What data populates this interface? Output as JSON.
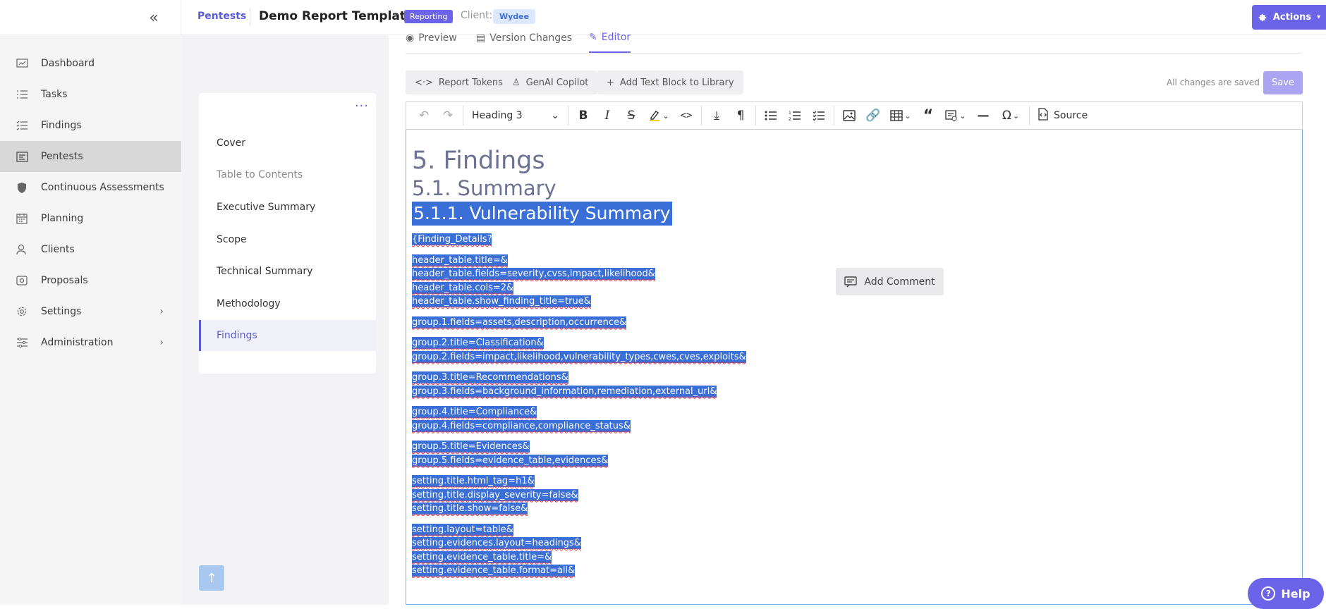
{
  "topbar": {
    "breadcrumb": "Pentests",
    "title": "Demo Report Template",
    "status_badge": "Reporting",
    "client_label": "Client:",
    "client_name": "Wydee",
    "actions_label": "Actions"
  },
  "sidebar": {
    "items": [
      {
        "label": "Dashboard",
        "icon": "dashboard-icon"
      },
      {
        "label": "Tasks",
        "icon": "tasks-icon"
      },
      {
        "label": "Findings",
        "icon": "findings-icon"
      },
      {
        "label": "Pentests",
        "icon": "pentests-icon",
        "active": true
      },
      {
        "label": "Continuous Assessments",
        "icon": "shield-icon"
      },
      {
        "label": "Planning",
        "icon": "calendar-icon"
      },
      {
        "label": "Clients",
        "icon": "clients-icon"
      },
      {
        "label": "Proposals",
        "icon": "proposals-icon"
      },
      {
        "label": "Settings",
        "icon": "gear-icon",
        "expandable": true
      },
      {
        "label": "Administration",
        "icon": "sliders-icon",
        "expandable": true
      }
    ]
  },
  "outline": {
    "items": [
      {
        "label": "Cover"
      },
      {
        "label": "Table to Contents",
        "muted": true
      },
      {
        "label": "Executive Summary"
      },
      {
        "label": "Scope"
      },
      {
        "label": "Technical Summary"
      },
      {
        "label": "Methodology"
      },
      {
        "label": "Findings",
        "active": true
      }
    ]
  },
  "tabs": {
    "preview": "Preview",
    "version_changes": "Version Changes",
    "editor": "Editor"
  },
  "editor_toolbar": {
    "report_tokens": "Report Tokens",
    "genai_copilot": "GenAI Copilot",
    "add_text_block": "Add Text Block to Library",
    "saved_status": "All changes are saved",
    "save": "Save"
  },
  "ck": {
    "heading_select": "Heading 3",
    "source": "Source"
  },
  "document": {
    "h2": "5. Findings",
    "h3": "5.1. Summary",
    "h4": "5.1.1. Vulnerability Summary",
    "blocks": [
      [
        "{Finding_Details?"
      ],
      [
        "header_table.title=&",
        "header_table.fields=severity,cvss,impact,likelihood&",
        "header_table.cols=2&",
        "header_table.show_finding_title=true&"
      ],
      [
        "group.1.fields=assets,description,occurrence&"
      ],
      [
        "group.2.title=Classification&",
        "group.2.fields=impact,likelihood,vulnerability_types,cwes,cves,exploits&"
      ],
      [
        "group.3.title=Recommendations&",
        "group.3.fields=background_information,remediation,external_url&"
      ],
      [
        "group.4.title=Compliance&",
        "group.4.fields=compliance,compliance_status&"
      ],
      [
        "group.5.title=Evidences&",
        "group.5.fields=evidence_table,evidences&"
      ],
      [
        "setting.title.html_tag=h1&",
        "setting.title.display_severity=false&",
        "setting.title.show=false&"
      ],
      [
        "setting.layout=table&",
        "setting.evidences.layout=headings&",
        "setting.evidence_table.title=&",
        "setting.evidence_table.format=all&"
      ]
    ]
  },
  "add_comment": "Add Comment",
  "help": "Help"
}
